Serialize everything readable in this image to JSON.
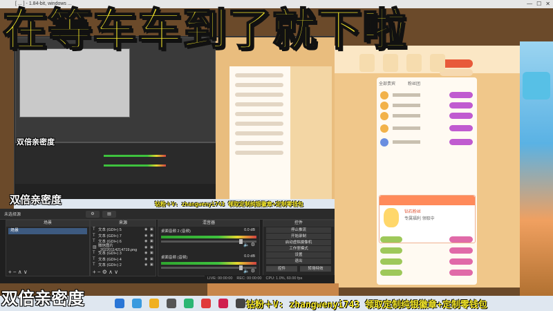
{
  "window": {
    "title": "[ ... ] - 1.84-bit, windows ..."
  },
  "overlay": {
    "big_title": "在等车车到了就下啦",
    "tag_mid": "双倍亲密度",
    "tag_bottom": "双倍亲密度",
    "tag_nested": "双倍亲密度",
    "promo_bottom": "钻粉＋V: zhangwenyi743 领取定制纯银徽章+定制零钱包",
    "promo_nested": "钻粉＋V: zhangwenyi743 领取定制纯银徽章+定制零钱包"
  },
  "obs": {
    "toolbar_label": "未选择源",
    "panels": {
      "scenes": "场景",
      "sources": "来源",
      "mixer": "混音器",
      "controls": "控件"
    },
    "scene_items": [
      "场景"
    ],
    "sources": [
      {
        "label": "文本 (GDI+) 5"
      },
      {
        "label": "文本 (GDI+) 7"
      },
      {
        "label": "文本 (GDI+) 6"
      },
      {
        "label": "微信图片_20220114214719.png"
      },
      {
        "label": "文本 (GDI+) 3"
      },
      {
        "label": "文本 (GDI+) 4"
      },
      {
        "label": "文本 (GDI+) 2"
      }
    ],
    "mixer": [
      {
        "name": "桌面音频 2 (音频)",
        "db": "0.0 dB"
      },
      {
        "name": "桌面音频 (音频)",
        "db": "0.0 dB"
      }
    ],
    "controls": [
      "停止推流",
      "开始录制",
      "启动虚拟摄像机",
      "工作室模式",
      "设置",
      "退出"
    ],
    "control_tabs": [
      "控件",
      "转场特效"
    ],
    "footer_add": "+ −  ∧ ∨",
    "status": {
      "live": "LIVE: 00:00:00",
      "rec": "REC: 00:00:00",
      "cpu": "CPU: 1.0%, 60.00 fps"
    }
  },
  "webpage": {
    "chat_tabs": [
      "全部贵宾",
      "粉丝团"
    ],
    "popup_title": "钻石粉丝",
    "popup_sub": "专属福利 领取中"
  },
  "colors": {
    "overlay_yellow": "#f5e82a",
    "obs_dark": "#1f1f1f",
    "web_orange": "#f0c78a"
  }
}
